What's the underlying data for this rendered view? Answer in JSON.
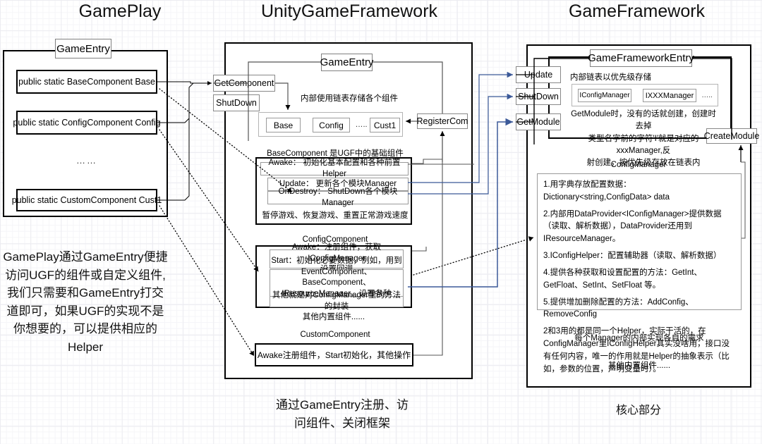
{
  "columns": {
    "left": {
      "title": "GamePlay",
      "caption": "GamePlay通过GameEntry便捷访问UGF的组件或自定义组件,我们只需要和GameEntry打交道即可，如果UGF的实现不是你想要的，可以提供相应的Helper"
    },
    "middle": {
      "title": "UnityGameFramework",
      "caption_line1": "通过GameEntry注册、访",
      "caption_line2": "问组件、关闭框架"
    },
    "right": {
      "title": "GameFramework",
      "caption": "核心部分"
    }
  },
  "gameplay": {
    "entry_label": "GameEntry",
    "fields": [
      "public static BaseComponent Base",
      "public static ConfigComponent Config",
      "public static CustomComponent Cust1"
    ],
    "ellipsis": "……"
  },
  "ugf": {
    "entry_label": "GameEntry",
    "methods": [
      "GetComponent",
      "ShutDown"
    ],
    "register_label": "RegisterCom",
    "linked_list_note": "内部使用链表存储各个组件",
    "components_chain": [
      "Base",
      "Config",
      "Cust1"
    ],
    "chain_dots": "…..",
    "base_component": {
      "title": "BaseComponent 是UGF中的基础组件",
      "rows": [
        "Awake： 初始化基本配置和各种前置Helper",
        "Update： 更新各个模块Manager",
        "OnDestroy： ShutDown各个模块Manager"
      ],
      "footer": "暂停游戏、恢复游戏、重置正常游戏速度"
    },
    "config_component": {
      "title": "ConfigComponent",
      "rows": [
        "Awake：注册组件，获取IConfigManager\n设置回调",
        "Start：初始化必要数据，例如，用到\nEventComponent、BaseComponent、\nIResourceManager，设置各种Helper",
        "其他就是对ConfigManager里的方法的封装"
      ],
      "footer": "其他内置组件......"
    },
    "custom_component": {
      "title": "CustomComponent",
      "row": "Awake注册组件，Start初始化，其他操作"
    }
  },
  "gf": {
    "entry_label": "GameFrameworkEntry",
    "methods": [
      "Update",
      "ShutDown",
      "GetModule"
    ],
    "create_module_label": "CreateModule",
    "priority_note": "内部链表以优先级存储",
    "managers": [
      "IConfigManager",
      "IXXXManager"
    ],
    "manager_dots": "…..",
    "getmodule_note": "GetModule时，没有的话就创建，创建时去掉\n类型名字前的字符'I'就是对应的xxxManager,反\n射创建，按优先级存放在链表内",
    "config_manager": {
      "title": "ConfigManager",
      "items": [
        "1.用字典存放配置数据：Dictionary<string,ConfigData> data",
        "2.内部用DataProvider<IConfigManager>提供数据（读取、解析数据），DataProvider还用到IResourceManager。",
        "3.IConfigHelper：配置辅助器（读取、解析数据）",
        "4.提供各种获取和设置配置的方法：GetInt、GetFloat、SetInt、SetFloat 等。",
        "5.提供增加删除配置的方法：AddConfig、RemoveConfig",
        "2和3用的都是同一个Helper，实际干活的，在ConfigManager里IConfigHelper其实没啥用，接口没有任何内容，唯一的作用就是Helper的抽象表示（比如，参数的位置，声明变量时）。"
      ]
    },
    "manager_note": "每个Manager的内部实现各自的需求",
    "others_note": "其他内置组件......"
  },
  "colors": {
    "connector_black": "#000000",
    "connector_blue": "#3b5998",
    "border_black": "#000000",
    "border_grey": "#909090",
    "background": "#ffffff",
    "grid": "#ececf1"
  }
}
